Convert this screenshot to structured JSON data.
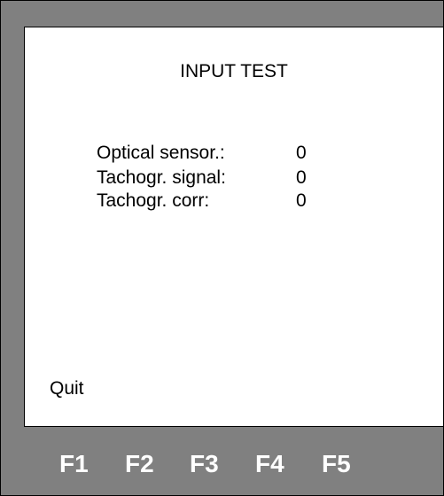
{
  "screen": {
    "title": "INPUT TEST",
    "rows": [
      {
        "label": "Optical sensor.:",
        "value": "0"
      },
      {
        "label": "Tachogr. signal:",
        "value": "0"
      },
      {
        "label": "Tachogr. corr:",
        "value": "0"
      }
    ],
    "softkey_label": "Quit"
  },
  "function_keys": [
    "F1",
    "F2",
    "F3",
    "F4",
    "F5"
  ],
  "colors": {
    "device_frame": "#808080",
    "screen_background": "#ffffff",
    "text": "#000000",
    "function_key_text": "#ffffff"
  }
}
